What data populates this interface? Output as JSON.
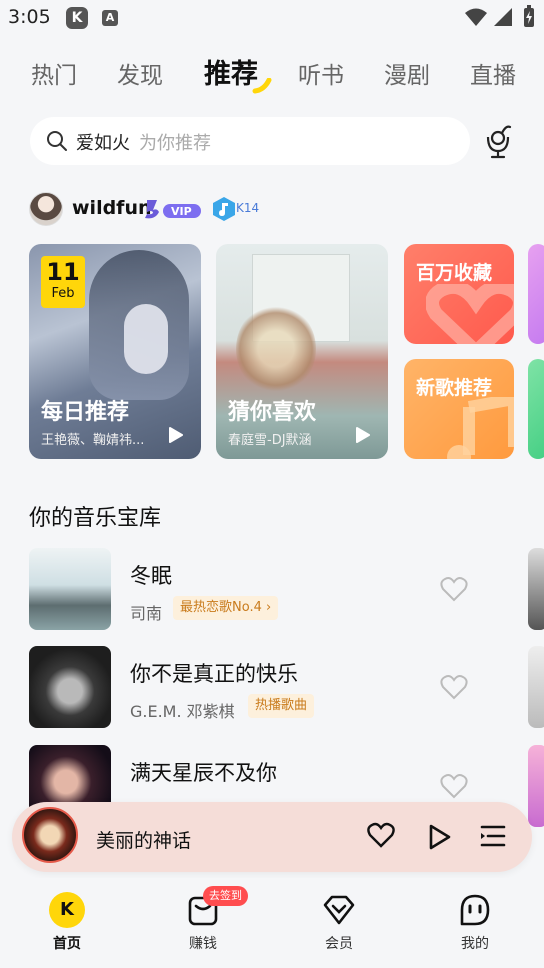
{
  "status_bar": {
    "time": "3:05",
    "app_icon_k": "K",
    "app_icon_a": "A"
  },
  "top_tabs": [
    {
      "label": "热门",
      "active": false
    },
    {
      "label": "发现",
      "active": false
    },
    {
      "label": "推荐",
      "active": true
    },
    {
      "label": "听书",
      "active": false
    },
    {
      "label": "漫剧",
      "active": false
    },
    {
      "label": "直播",
      "active": false
    }
  ],
  "search": {
    "term": "爱如火",
    "hint": "为你推荐"
  },
  "user": {
    "name": "wildfun",
    "vip_label": "VIP",
    "level": "K14"
  },
  "cards": {
    "daily": {
      "day": "11",
      "month": "Feb",
      "title": "每日推荐",
      "subtitle": "王艳薇、鞠婧祎..."
    },
    "guess": {
      "title": "猜你喜欢",
      "subtitle": "春庭雪-DJ默涵"
    },
    "favorites": {
      "title": "百万收藏"
    },
    "new_songs": {
      "title": "新歌推荐"
    }
  },
  "library": {
    "title": "你的音乐宝库",
    "songs": [
      {
        "title": "冬眠",
        "artist": "司南",
        "tag": "最热恋歌No.4"
      },
      {
        "title": "你不是真正的快乐",
        "artist": "G.E.M. 邓紫棋",
        "tag": "热播歌曲"
      },
      {
        "title": "满天星辰不及你",
        "artist": "",
        "tag": ""
      }
    ]
  },
  "player": {
    "song_title": "美丽的神话"
  },
  "bottom_nav": [
    {
      "label": "首页",
      "active": true
    },
    {
      "label": "赚钱",
      "active": false,
      "badge": "去签到"
    },
    {
      "label": "会员",
      "active": false
    },
    {
      "label": "我的",
      "active": false
    }
  ],
  "colors": {
    "accent_yellow": "#ffd60a",
    "tag_bg": "#fdf0dc",
    "tag_text": "#c97b1c",
    "badge_red": "#ff4d4f",
    "player_bg": "#f5ddd8"
  }
}
